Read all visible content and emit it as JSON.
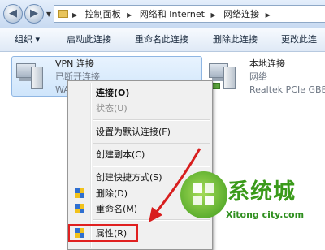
{
  "breadcrumb": {
    "items": [
      "控制面板",
      "网络和 Internet",
      "网络连接"
    ]
  },
  "toolbar": {
    "organize": "组织 ▾",
    "start_connection": "启动此连接",
    "rename_connection": "重命名此连接",
    "delete_connection": "删除此连接",
    "change_settings": "更改此连"
  },
  "connections": [
    {
      "name": "VPN 连接",
      "status": "已断开连接",
      "detail": "WA"
    },
    {
      "name": "本地连接",
      "status": "网络",
      "detail": "Realtek PCIe GBE"
    }
  ],
  "context_menu": {
    "items": [
      {
        "label": "连接(O)",
        "bold": true
      },
      {
        "label": "状态(U)",
        "disabled": true
      },
      {
        "label": "设置为默认连接(F)"
      },
      {
        "label": "创建副本(C)"
      },
      {
        "label": "创建快捷方式(S)"
      },
      {
        "label": "删除(D)",
        "icon": "uac-shield-icon"
      },
      {
        "label": "重命名(M)",
        "icon": "uac-shield-icon"
      },
      {
        "label": "属性(R)",
        "icon": "uac-shield-icon"
      }
    ]
  },
  "watermark": {
    "brand": "系统城",
    "url": "Xitong city.com"
  },
  "colors": {
    "highlight": "#e02020",
    "arrow": "#d81e1e",
    "watermark": "#3a9a1a"
  }
}
